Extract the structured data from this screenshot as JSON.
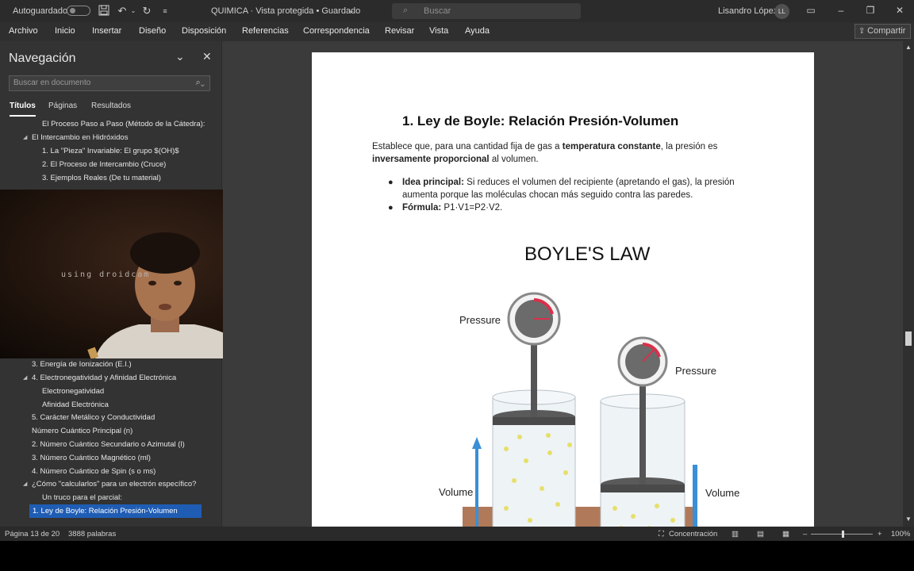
{
  "titlebar": {
    "autosave_label": "Autoguardado",
    "doc_title": "QUIMICA  ·  Vista protegida  •  Guardado",
    "search_placeholder": "Buscar",
    "user_name": "Lisandro López",
    "user_initials": "LL"
  },
  "menu": {
    "items": [
      "Archivo",
      "Inicio",
      "Insertar",
      "Diseño",
      "Disposición",
      "Referencias",
      "Correspondencia",
      "Revisar",
      "Vista",
      "Ayuda"
    ],
    "share_label": "Compartir"
  },
  "nav": {
    "title": "Navegación",
    "search_placeholder": "Buscar en documento",
    "tabs": [
      "Títulos",
      "Páginas",
      "Resultados"
    ],
    "items_top": [
      "El Proceso Paso a Paso (Método de la Cátedra):",
      "El Intercambio en Hidróxidos",
      "1. La \"Pieza\" Invariable: El grupo $(OH)$",
      "2. El Proceso de Intercambio (Cruce)",
      "3. Ejemplos Reales (De tu material)"
    ],
    "items_bottom": [
      "3. Energía de Ionización (E.I.)",
      "4. Electronegatividad y Afinidad Electrónica",
      "Electronegatividad",
      "Afinidad Electrónica",
      "5. Carácter Metálico y Conductividad",
      "Número Cuántico Principal (n)",
      "2. Número Cuántico Secundario o Azimutal (l)",
      "3. Número Cuántico Magnético (ml)",
      "4. Número Cuántico de Spin (s o ms)",
      "¿Cómo \"calcularlos\" para un electrón específico?",
      "Un truco para el parcial:",
      "1. Ley de Boyle: Relación Presión-Volumen"
    ]
  },
  "webcam": {
    "overlay_text": "using droidcam"
  },
  "document": {
    "heading": "1. Ley de Boyle: Relación Presión-Volumen",
    "para_part1": "Establece que, para una cantidad fija de gas a ",
    "para_bold1": "temperatura constante",
    "para_part2": ", la presión es ",
    "para_bold2": "inversamente proporcional",
    "para_part3": " al volumen.",
    "bullet1_title": "Idea principal:",
    "bullet1_text": " Si reduces el volumen del recipiente (apretando el gas), la presión aumenta porque las moléculas chocan más seguido contra las paredes.",
    "bullet2_title": "Fórmula:",
    "bullet2_text": " P1·V1=P2·V2.",
    "figure_title": "BOYLE'S LAW",
    "label_pressure": "Pressure",
    "label_volume": "Volume"
  },
  "status": {
    "page": "Página 13 de 20",
    "words": "3888 palabras",
    "focus": "Concentración",
    "zoom": "100%"
  },
  "colors": {
    "accent": "#1f5db4",
    "volume_arrow": "#3a8fd6",
    "gauge_needle": "#d9304a"
  }
}
